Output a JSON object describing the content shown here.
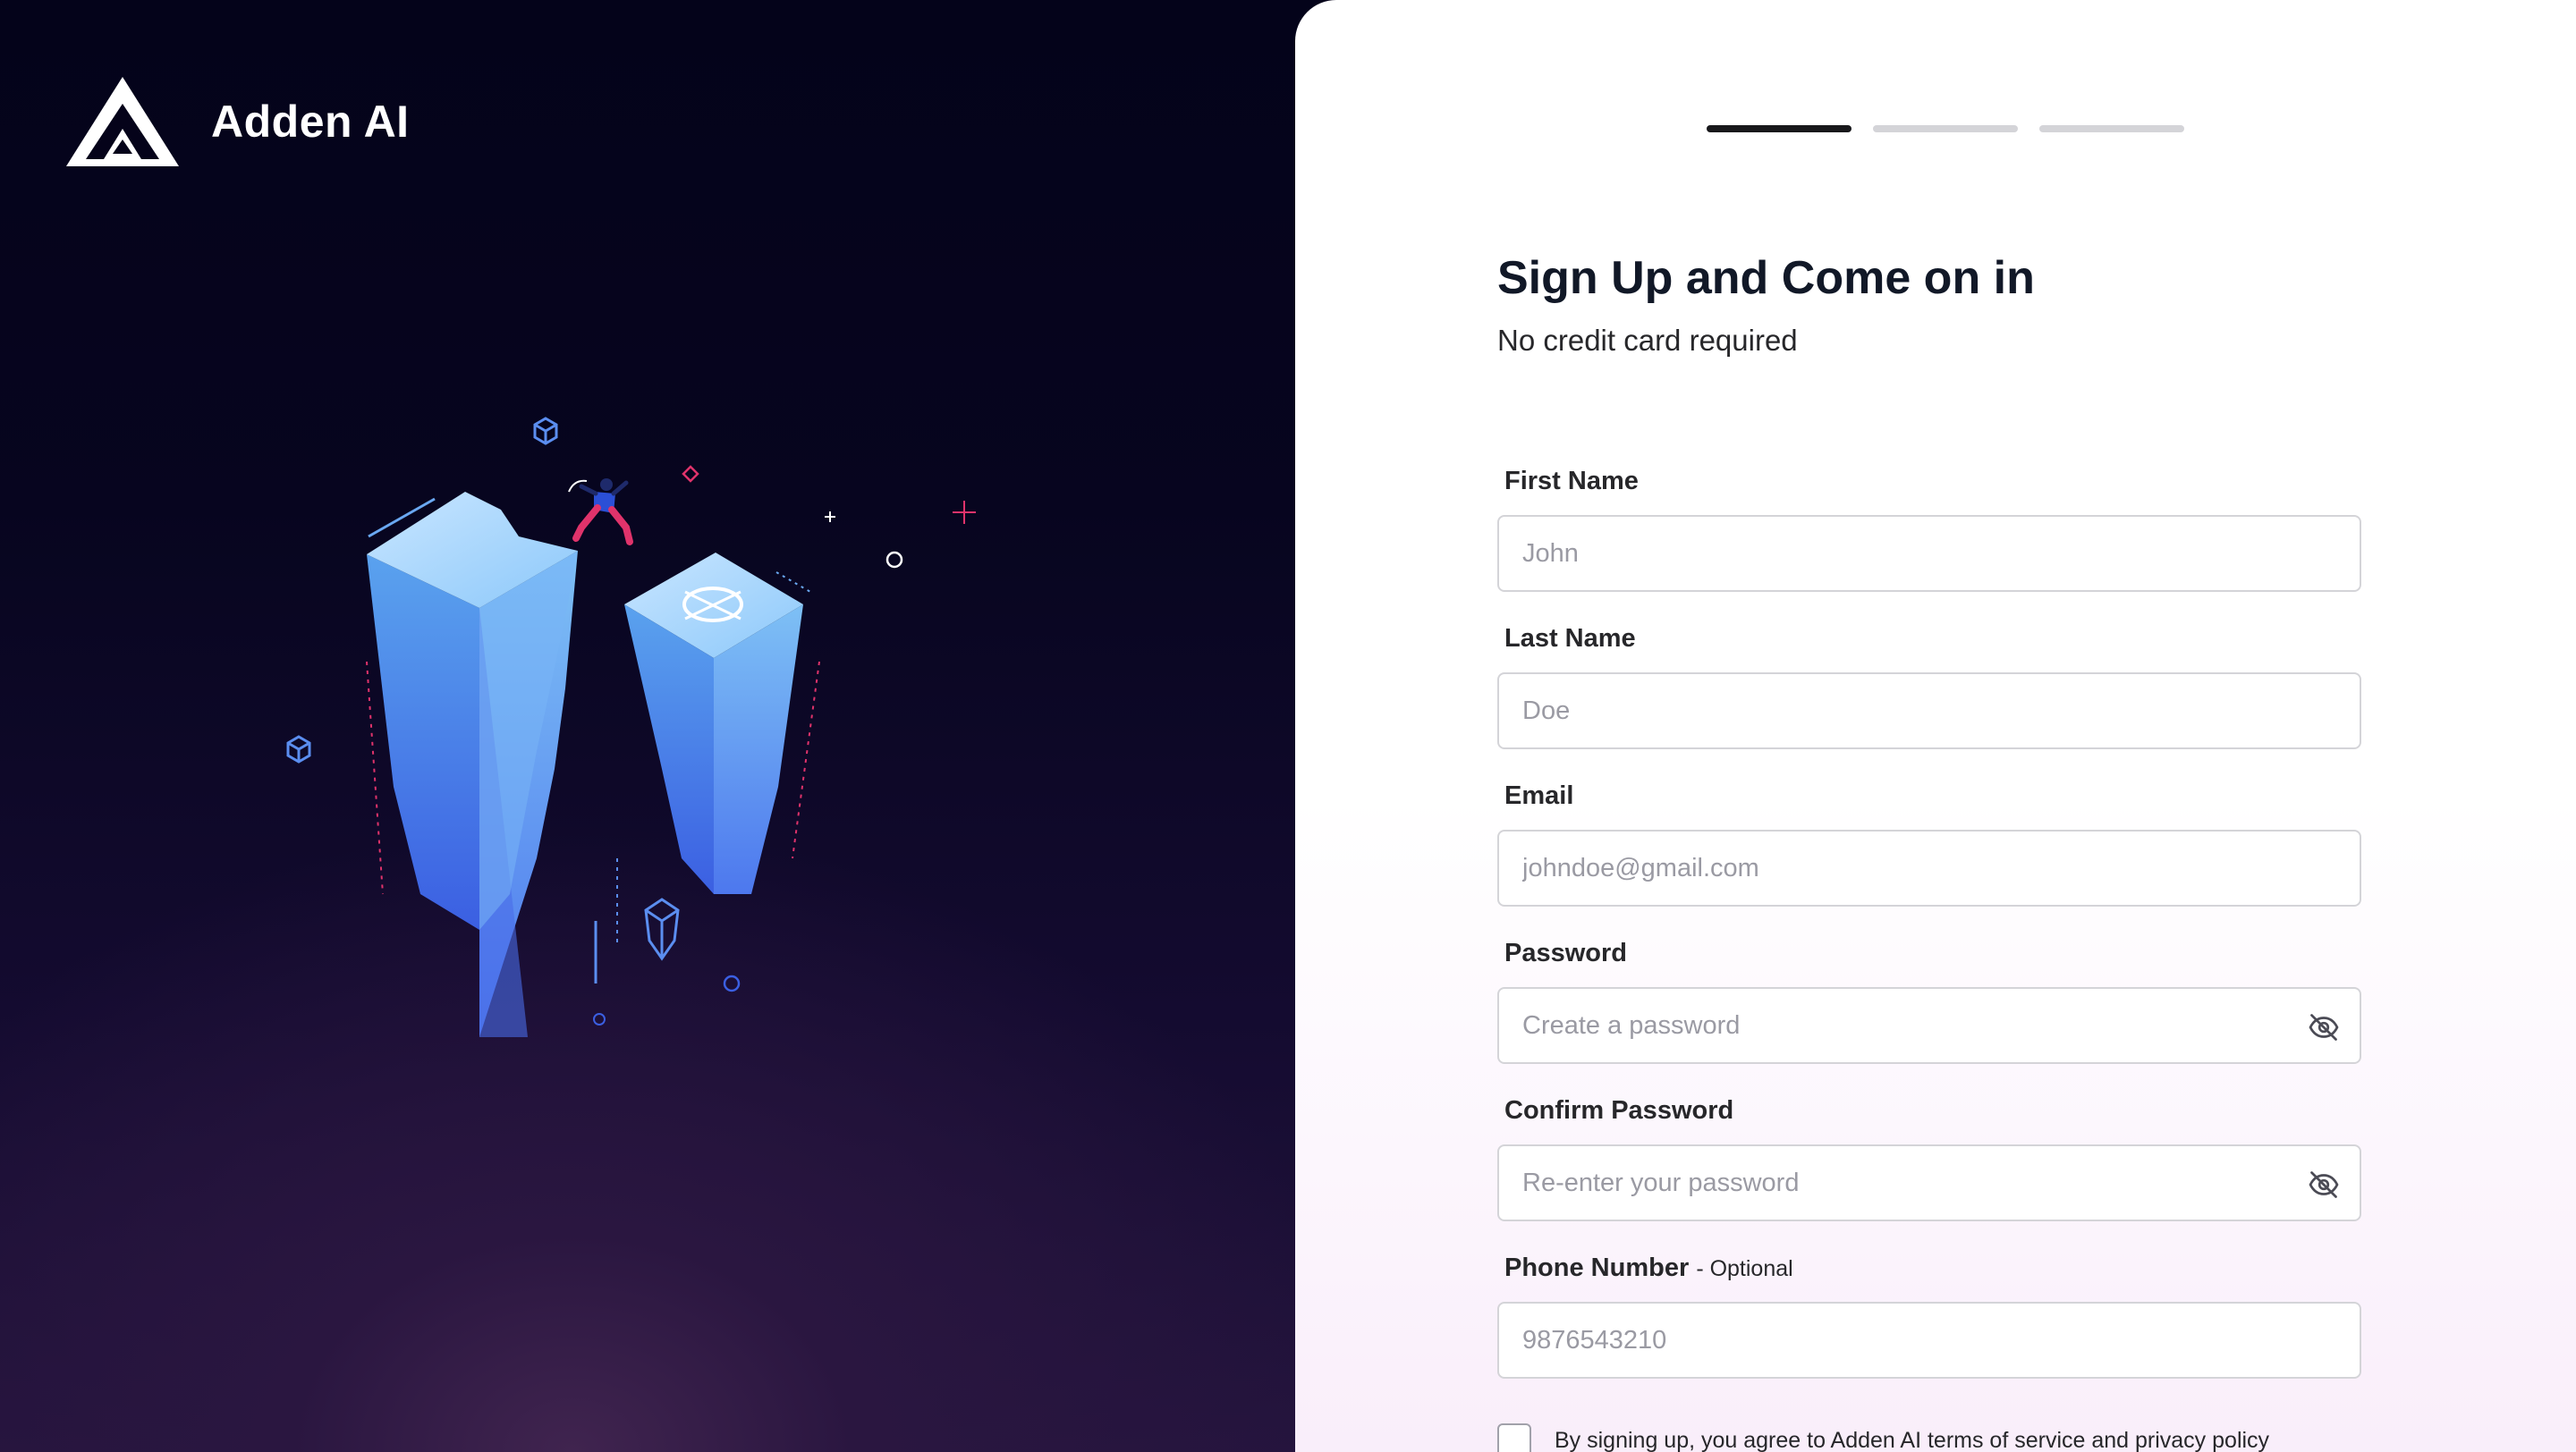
{
  "brand": {
    "name": "Adden AI"
  },
  "progress": {
    "current_step": 1,
    "total_steps": 3
  },
  "form": {
    "title": "Sign Up and Come on in",
    "subtitle": "No credit card required",
    "fields": {
      "first_name": {
        "label": "First Name",
        "placeholder": "John"
      },
      "last_name": {
        "label": "Last Name",
        "placeholder": "Doe"
      },
      "email": {
        "label": "Email",
        "placeholder": "johndoe@gmail.com"
      },
      "password": {
        "label": "Password",
        "placeholder": "Create a password",
        "toggle_icon": "eye-off-icon"
      },
      "confirm_password": {
        "label": "Confirm Password",
        "placeholder": "Re-enter your password",
        "toggle_icon": "eye-off-icon"
      },
      "phone": {
        "label": "Phone Number",
        "optional_note": "- Optional",
        "placeholder": "9876543210"
      }
    },
    "terms": {
      "checked": false,
      "text": "By signing up, you agree to Adden AI terms of service and privacy policy"
    }
  },
  "colors": {
    "left_background": "#05031a",
    "accent_purple": "#40244f",
    "progress_active": "#18181b",
    "progress_inactive": "#d4d4d8",
    "illustration_blue": "#5b8ef0",
    "illustration_pink": "#e0336b"
  }
}
